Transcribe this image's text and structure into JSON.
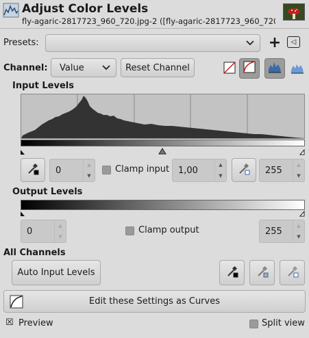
{
  "header": {
    "title": "Adjust Color Levels",
    "subtitle": "fly-agaric-2817723_960_720.jpg-2 ([fly-agaric-2817723_960_720..."
  },
  "presets": {
    "label": "Presets:",
    "value": "",
    "add_symbol": "+",
    "menu_symbol": "◁"
  },
  "channel": {
    "label": "Channel:",
    "selected": "Value",
    "reset_label": "Reset Channel"
  },
  "input_levels": {
    "title": "Input Levels",
    "low_value": "0",
    "gamma_value": "1,00",
    "high_value": "255",
    "clamp_label": "Clamp input"
  },
  "output_levels": {
    "title": "Output Levels",
    "low_value": "0",
    "high_value": "255",
    "clamp_label": "Clamp output"
  },
  "all_channels": {
    "title": "All Channels",
    "auto_label": "Auto Input Levels"
  },
  "curves_button_label": "Edit these Settings as Curves",
  "preview": {
    "label": "Preview",
    "checked": true,
    "mark": "☒"
  },
  "split_view": {
    "label": "Split view",
    "checked": false
  },
  "colors": {
    "background": "#dcdcdc",
    "histogram_fill": "#333333",
    "histogram_bg": "#c3c3c3"
  }
}
